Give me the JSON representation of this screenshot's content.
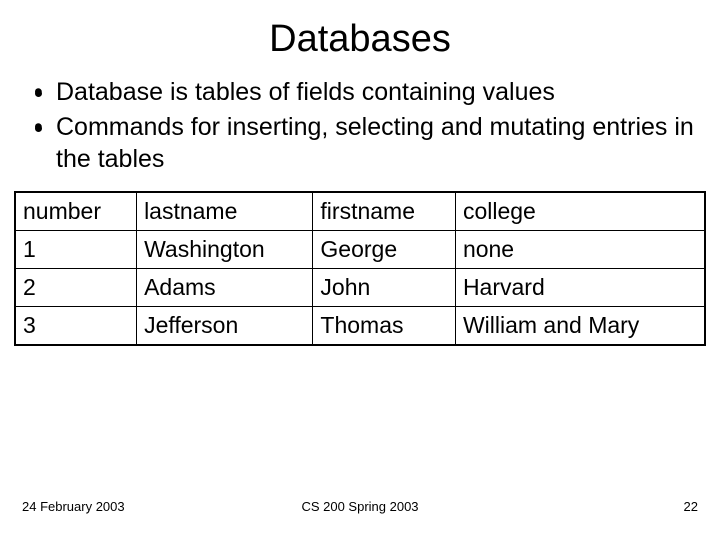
{
  "title": "Databases",
  "bullets": [
    "Database is tables of fields containing values",
    "Commands for inserting, selecting and mutating entries in the tables"
  ],
  "table": {
    "headers": [
      "number",
      "lastname",
      "firstname",
      "college"
    ],
    "rows": [
      [
        "1",
        "Washington",
        "George",
        "none"
      ],
      [
        "2",
        "Adams",
        "John",
        "Harvard"
      ],
      [
        "3",
        "Jefferson",
        "Thomas",
        "William and Mary"
      ]
    ]
  },
  "footer": {
    "date": "24 February 2003",
    "course": "CS 200 Spring 2003",
    "page": "22"
  }
}
